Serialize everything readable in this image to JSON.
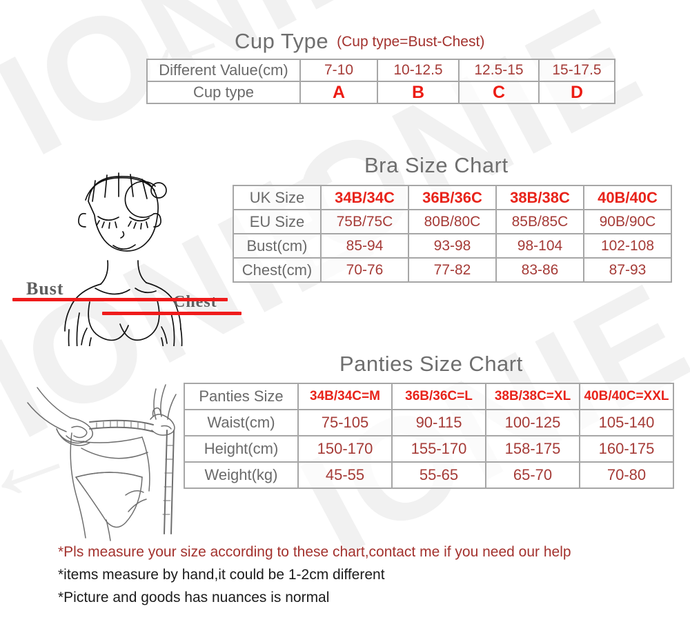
{
  "watermark": {
    "text": "IONIE",
    "arrow_glyph": "←"
  },
  "cup_section": {
    "title": "Cup Type",
    "subtitle": "(Cup type=Bust-Chest)",
    "rows": [
      {
        "label": "Different Value(cm)",
        "values": [
          "7-10",
          "10-12.5",
          "12.5-15",
          "15-17.5"
        ]
      },
      {
        "label": "Cup type",
        "values": [
          "A",
          "B",
          "C",
          "D"
        ]
      }
    ]
  },
  "bra_section": {
    "title": "Bra Size Chart",
    "rows": [
      {
        "label": "UK Size",
        "unit": "",
        "values": [
          "34B/34C",
          "36B/36C",
          "38B/38C",
          "40B/40C"
        ]
      },
      {
        "label": "EU Size",
        "unit": "",
        "values": [
          "75B/75C",
          "80B/80C",
          "85B/85C",
          "90B/90C"
        ]
      },
      {
        "label": "Bust",
        "unit": "(cm)",
        "values": [
          "85-94",
          "93-98",
          "98-104",
          "102-108"
        ]
      },
      {
        "label": "Chest",
        "unit": "(cm)",
        "values": [
          "70-76",
          "77-82",
          "83-86",
          "87-93"
        ]
      }
    ]
  },
  "panties_section": {
    "title": "Panties Size Chart",
    "rows": [
      {
        "label": "Panties Size",
        "unit": "",
        "values": [
          "34B/34C=M",
          "36B/36C=L",
          "38B/38C=XL",
          "40B/40C=XXL"
        ]
      },
      {
        "label": "Waist",
        "unit": "(cm)",
        "values": [
          "75-105",
          "90-115",
          "100-125",
          "105-140"
        ]
      },
      {
        "label": "Height",
        "unit": "(cm)",
        "values": [
          "150-170",
          "155-170",
          "158-175",
          "160-175"
        ]
      },
      {
        "label": "Weight",
        "unit": "(kg)",
        "values": [
          "45-55",
          "55-65",
          "65-70",
          "70-80"
        ]
      }
    ]
  },
  "illustration": {
    "bust_label": "Bust",
    "chest_label": "Chest"
  },
  "notes": [
    "*Pls measure your size according to these chart,contact me if you need our help",
    "*items measure by hand,it could be 1-2cm different",
    "*Picture and goods has nuances is normal"
  ],
  "colors": {
    "title_gray": "#6e6e6e",
    "label_gray": "#6a6a6a",
    "value_dark_red": "#a53b37",
    "value_bright_red": "#e8231a",
    "cup_letter_red": "#ec1c14",
    "note_red": "#a3322e",
    "border_gray": "#a6a6a6",
    "measure_line_red": "#ef1b1b"
  }
}
